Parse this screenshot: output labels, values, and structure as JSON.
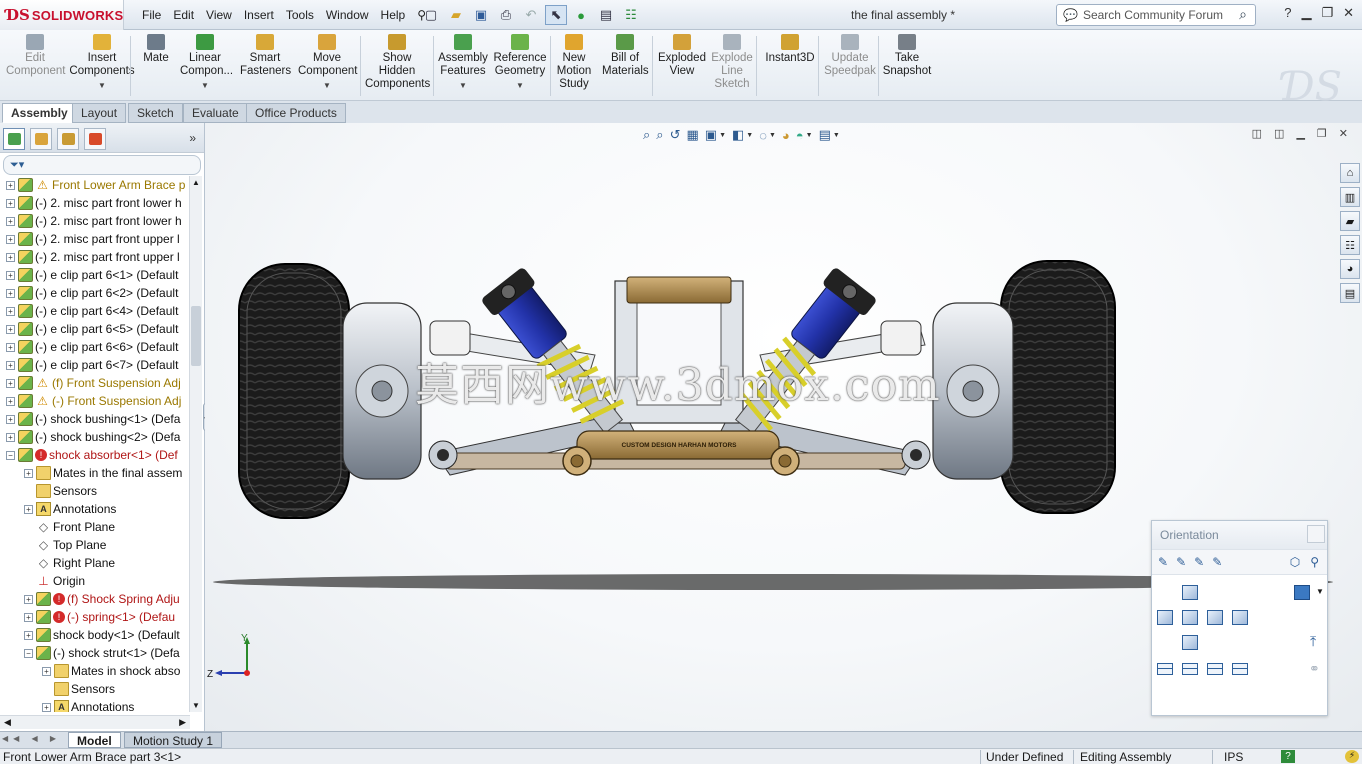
{
  "app": {
    "brand": "SOLIDWORKS",
    "document_title": "the final assembly *"
  },
  "menu": [
    "File",
    "Edit",
    "View",
    "Insert",
    "Tools",
    "Window",
    "Help"
  ],
  "search": {
    "placeholder": "Search Community Forum"
  },
  "commands": [
    {
      "l1": "Edit",
      "l2": "Component",
      "l3": "",
      "caret": false,
      "disabled": true,
      "color": "#9aa7b4"
    },
    {
      "l1": "Insert",
      "l2": "Components",
      "l3": "",
      "caret": true,
      "disabled": false,
      "color": "#e2b23a"
    },
    {
      "l1": "Mate",
      "l2": "",
      "l3": "",
      "caret": false,
      "disabled": false,
      "color": "#6d7b8a"
    },
    {
      "l1": "Linear",
      "l2": "Compon...",
      "l3": "",
      "caret": true,
      "disabled": false,
      "color": "#3d9a42"
    },
    {
      "l1": "Smart",
      "l2": "Fasteners",
      "l3": "",
      "caret": false,
      "disabled": false,
      "color": "#d8a838"
    },
    {
      "l1": "Move",
      "l2": "Component",
      "l3": "",
      "caret": true,
      "disabled": false,
      "color": "#d9a43c"
    },
    {
      "l1": "Show",
      "l2": "Hidden",
      "l3": "Components",
      "caret": false,
      "disabled": false,
      "color": "#c79a2e"
    },
    {
      "l1": "Assembly",
      "l2": "Features",
      "l3": "",
      "caret": true,
      "disabled": false,
      "color": "#4aa04e"
    },
    {
      "l1": "Reference",
      "l2": "Geometry",
      "l3": "",
      "caret": true,
      "disabled": false,
      "color": "#6bb34a"
    },
    {
      "l1": "New",
      "l2": "Motion",
      "l3": "Study",
      "caret": false,
      "disabled": false,
      "color": "#e0a52e"
    },
    {
      "l1": "Bill of",
      "l2": "Materials",
      "l3": "",
      "caret": false,
      "disabled": false,
      "color": "#5a9a48"
    },
    {
      "l1": "Exploded",
      "l2": "View",
      "l3": "",
      "caret": false,
      "disabled": false,
      "color": "#d3a13a"
    },
    {
      "l1": "Explode",
      "l2": "Line",
      "l3": "Sketch",
      "caret": false,
      "disabled": true,
      "color": "#a9b3bd"
    },
    {
      "l1": "Instant3D",
      "l2": "",
      "l3": "",
      "caret": false,
      "disabled": false,
      "color": "#d0a232"
    },
    {
      "l1": "Update",
      "l2": "Speedpak",
      "l3": "",
      "caret": false,
      "disabled": true,
      "color": "#a9b3bd"
    },
    {
      "l1": "Take",
      "l2": "Snapshot",
      "l3": "",
      "caret": false,
      "disabled": false,
      "color": "#777f88"
    }
  ],
  "tabs": [
    "Assembly",
    "Layout",
    "Sketch",
    "Evaluate",
    "Office Products"
  ],
  "tree": [
    {
      "text": "Front Lower Arm Brace p",
      "icon": "part",
      "icon2": "warn",
      "tone": "y",
      "pm": "+",
      "indent": 0
    },
    {
      "text": "(-) 2. misc part front lower h",
      "icon": "part",
      "icon2": "",
      "tone": "",
      "pm": "+",
      "indent": 0
    },
    {
      "text": "(-) 2. misc part front lower h",
      "icon": "part",
      "icon2": "",
      "tone": "",
      "pm": "+",
      "indent": 0
    },
    {
      "text": "(-) 2. misc part front upper l",
      "icon": "part",
      "icon2": "",
      "tone": "",
      "pm": "+",
      "indent": 0
    },
    {
      "text": "(-) 2. misc part front upper l",
      "icon": "part",
      "icon2": "",
      "tone": "",
      "pm": "+",
      "indent": 0
    },
    {
      "text": "(-) e clip part 6<1> (Default",
      "icon": "part",
      "icon2": "",
      "tone": "",
      "pm": "+",
      "indent": 0
    },
    {
      "text": "(-) e clip part 6<2> (Default",
      "icon": "part",
      "icon2": "",
      "tone": "",
      "pm": "+",
      "indent": 0
    },
    {
      "text": "(-) e clip part 6<4> (Default",
      "icon": "part",
      "icon2": "",
      "tone": "",
      "pm": "+",
      "indent": 0
    },
    {
      "text": "(-) e clip part 6<5> (Default",
      "icon": "part",
      "icon2": "",
      "tone": "",
      "pm": "+",
      "indent": 0
    },
    {
      "text": "(-) e clip part 6<6> (Default",
      "icon": "part",
      "icon2": "",
      "tone": "",
      "pm": "+",
      "indent": 0
    },
    {
      "text": "(-) e clip part 6<7> (Default",
      "icon": "part",
      "icon2": "",
      "tone": "",
      "pm": "+",
      "indent": 0
    },
    {
      "text": "(f) Front Suspension Adj",
      "icon": "part",
      "icon2": "warn",
      "tone": "y",
      "pm": "+",
      "indent": 0
    },
    {
      "text": "(-) Front Suspension Adj",
      "icon": "part",
      "icon2": "warn",
      "tone": "y",
      "pm": "+",
      "indent": 0
    },
    {
      "text": "(-) shock bushing<1> (Defa",
      "icon": "part",
      "icon2": "",
      "tone": "",
      "pm": "+",
      "indent": 0
    },
    {
      "text": "(-) shock bushing<2> (Defa",
      "icon": "part",
      "icon2": "",
      "tone": "",
      "pm": "+",
      "indent": 0
    },
    {
      "text": "shock absorber<1> (Def",
      "icon": "part",
      "icon2": "err",
      "tone": "r",
      "pm": "-",
      "indent": 0
    },
    {
      "text": "Mates in the final assem",
      "icon": "folder",
      "icon2": "",
      "tone": "",
      "pm": "+",
      "indent": 1
    },
    {
      "text": "Sensors",
      "icon": "folder",
      "icon2": "",
      "tone": "",
      "pm": "",
      "indent": 1
    },
    {
      "text": "Annotations",
      "icon": "ann",
      "icon2": "",
      "tone": "",
      "pm": "+",
      "indent": 1
    },
    {
      "text": "Front Plane",
      "icon": "plane",
      "icon2": "",
      "tone": "",
      "pm": "",
      "indent": 1
    },
    {
      "text": "Top Plane",
      "icon": "plane",
      "icon2": "",
      "tone": "",
      "pm": "",
      "indent": 1
    },
    {
      "text": "Right Plane",
      "icon": "plane",
      "icon2": "",
      "tone": "",
      "pm": "",
      "indent": 1
    },
    {
      "text": "Origin",
      "icon": "origin",
      "icon2": "",
      "tone": "",
      "pm": "",
      "indent": 1
    },
    {
      "text": "(f) Shock Spring Adju",
      "icon": "part",
      "icon2": "err",
      "tone": "r",
      "pm": "+",
      "indent": 1
    },
    {
      "text": "(-) spring<1> (Defau",
      "icon": "part",
      "icon2": "err",
      "tone": "r",
      "pm": "+",
      "indent": 1
    },
    {
      "text": "shock body<1> (Default",
      "icon": "part",
      "icon2": "",
      "tone": "",
      "pm": "+",
      "indent": 1
    },
    {
      "text": "(-) shock strut<1> (Defa",
      "icon": "part",
      "icon2": "",
      "tone": "",
      "pm": "-",
      "indent": 1
    },
    {
      "text": "Mates in shock abso",
      "icon": "folder",
      "icon2": "",
      "tone": "",
      "pm": "+",
      "indent": 2
    },
    {
      "text": "Sensors",
      "icon": "folder",
      "icon2": "",
      "tone": "",
      "pm": "",
      "indent": 2
    },
    {
      "text": "Annotations",
      "icon": "ann",
      "icon2": "",
      "tone": "",
      "pm": "+",
      "indent": 2
    }
  ],
  "watermark_text": "莫西网www.3dmox.com",
  "axis_labels": {
    "y": "Y",
    "z": "Z"
  },
  "brace_label": "CUSTOM DESIGN HARHAN MOTORS",
  "orientation": {
    "title": "Orientation"
  },
  "bottom_tabs": [
    "Model",
    "Motion Study 1"
  ],
  "status": {
    "left": "Front Lower Arm Brace part 3<1>",
    "state": "Under Defined",
    "mode": "Editing Assembly",
    "units": "IPS"
  },
  "colors": {
    "brand_red": "#c8102e",
    "shock_blue": "#2232a8",
    "spring_yellow": "#d8cf2a",
    "brace_gold": "#b08a4c"
  }
}
